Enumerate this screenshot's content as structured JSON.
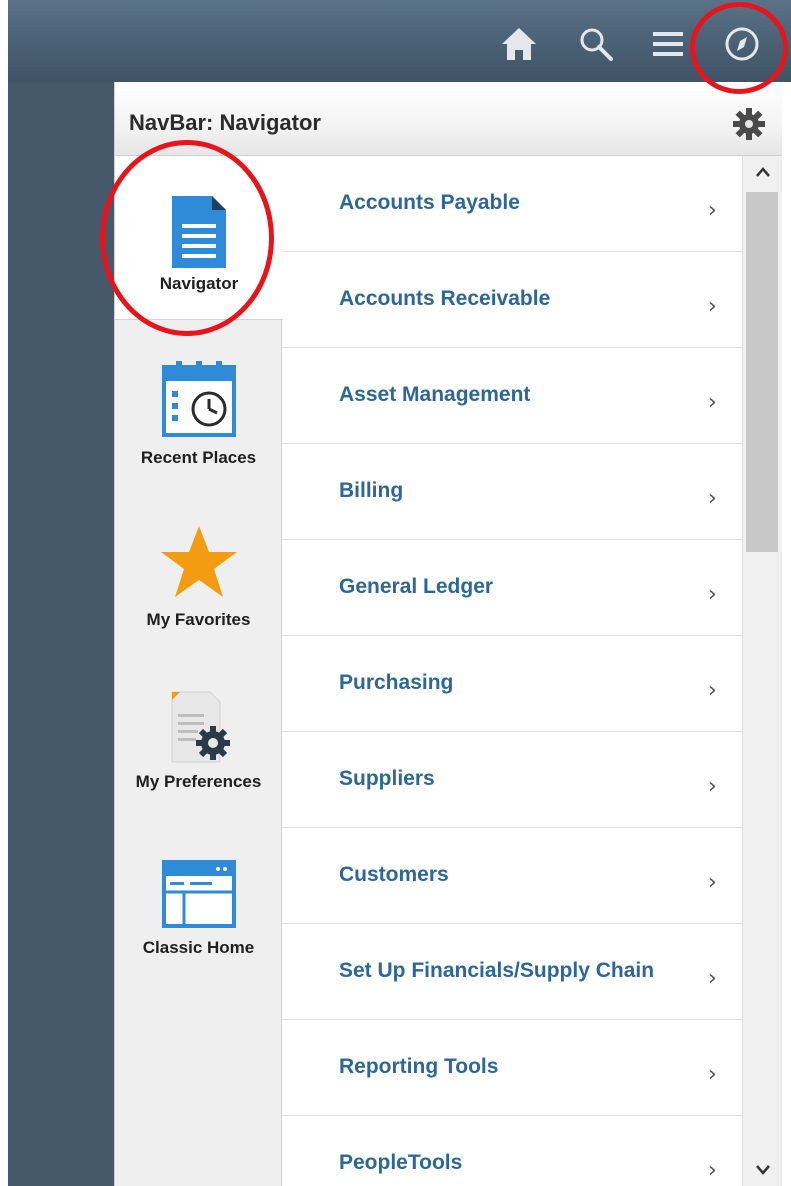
{
  "header": {
    "buttons": [
      {
        "icon": "home-icon"
      },
      {
        "icon": "search-icon"
      },
      {
        "icon": "menu-icon"
      },
      {
        "icon": "compass-icon"
      }
    ]
  },
  "panel": {
    "title": "NavBar: Navigator",
    "settings_icon": "gear-icon"
  },
  "tabs": [
    {
      "label": "Navigator",
      "icon": "document-icon",
      "selected": true
    },
    {
      "label": "Recent Places",
      "icon": "calendar-clock-icon"
    },
    {
      "label": "My Favorites",
      "icon": "star-icon"
    },
    {
      "label": "My Preferences",
      "icon": "document-gear-icon"
    },
    {
      "label": "Classic Home",
      "icon": "window-icon"
    }
  ],
  "menu": {
    "items": [
      {
        "label": "Accounts Payable",
        "chevron": "›"
      },
      {
        "label": "Accounts Receivable",
        "chevron": "›"
      },
      {
        "label": "Asset Management",
        "chevron": "›"
      },
      {
        "label": "Billing",
        "chevron": "›"
      },
      {
        "label": "General Ledger",
        "chevron": "›"
      },
      {
        "label": "Purchasing",
        "chevron": "›"
      },
      {
        "label": "Suppliers",
        "chevron": "›"
      },
      {
        "label": "Customers",
        "chevron": "›"
      },
      {
        "label": "Set Up Financials/Supply Chain",
        "chevron": "›"
      },
      {
        "label": "Reporting Tools",
        "chevron": "›"
      },
      {
        "label": "PeopleTools",
        "chevron": "›"
      }
    ]
  },
  "colors": {
    "banner": "#4a6073",
    "menu_text": "#2e6797",
    "icon_blue": "#2f8ad7",
    "star": "#f39c12",
    "annotation": "#e8141c"
  }
}
